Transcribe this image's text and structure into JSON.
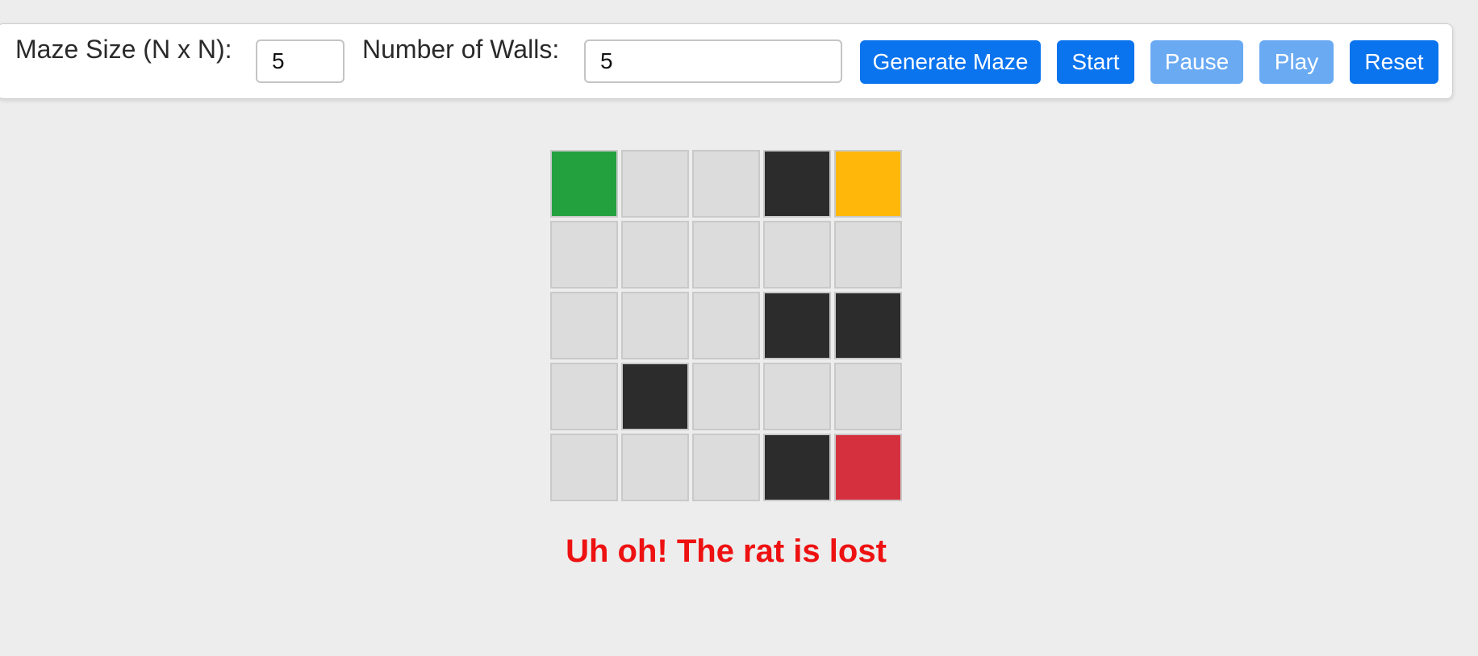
{
  "controls": {
    "size_label": "Maze Size (N x N):",
    "size_value": "5",
    "walls_label": "Number of Walls:",
    "walls_value": "5",
    "generate_label": "Generate Maze",
    "start_label": "Start",
    "pause_label": "Pause",
    "play_label": "Play",
    "reset_label": "Reset",
    "pause_enabled": false,
    "play_enabled": false
  },
  "maze": {
    "size": 5,
    "cells": [
      [
        "start",
        "open",
        "open",
        "wall",
        "goal"
      ],
      [
        "open",
        "open",
        "open",
        "open",
        "open"
      ],
      [
        "open",
        "open",
        "open",
        "wall",
        "wall"
      ],
      [
        "open",
        "wall",
        "open",
        "open",
        "open"
      ],
      [
        "open",
        "open",
        "open",
        "wall",
        "rat"
      ]
    ],
    "colors": {
      "open": "#dcdcdc",
      "wall": "#2c2c2c",
      "start": "#24a13f",
      "goal": "#ffb80a",
      "rat": "#d5303e"
    }
  },
  "status": {
    "message": "Uh oh! The rat is lost",
    "color": "#ee1111"
  },
  "theme": {
    "button_primary": "#0a73ee",
    "button_disabled": "#6aaaf3",
    "background": "#ededed"
  }
}
